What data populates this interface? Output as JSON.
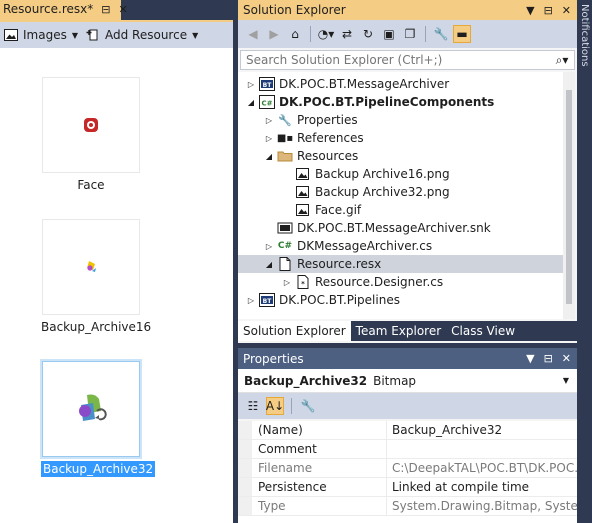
{
  "document_tab": {
    "title": "Resource.resx*",
    "pin_glyph": "⊟",
    "close_glyph": "✕"
  },
  "designer_toolbar": {
    "images_label": "Images",
    "add_resource_label": "Add Resource"
  },
  "resources": [
    {
      "name": "Face",
      "selected": false
    },
    {
      "name": "Backup_Archive16",
      "selected": false
    },
    {
      "name": "Backup_Archive32",
      "selected": true
    }
  ],
  "solution_explorer": {
    "title": "Solution Explorer",
    "search_placeholder": "Search Solution Explorer (Ctrl+;)",
    "tree": [
      {
        "label": "DK.POC.BT.MessageArchiver",
        "indent": 0,
        "expander": "▷",
        "icon": "bt-project-icon",
        "bold": false,
        "selected": false
      },
      {
        "label": "DK.POC.BT.PipelineComponents",
        "indent": 0,
        "expander": "◢",
        "icon": "csharp-project-icon",
        "bold": true,
        "selected": false
      },
      {
        "label": "Properties",
        "indent": 1,
        "expander": "▷",
        "icon": "wrench-icon",
        "bold": false,
        "selected": false
      },
      {
        "label": "References",
        "indent": 1,
        "expander": "▷",
        "icon": "references-icon",
        "bold": false,
        "selected": false
      },
      {
        "label": "Resources",
        "indent": 1,
        "expander": "◢",
        "icon": "folder-icon",
        "bold": false,
        "selected": false
      },
      {
        "label": "Backup Archive16.png",
        "indent": 2,
        "expander": "",
        "icon": "image-file-icon",
        "bold": false,
        "selected": false
      },
      {
        "label": "Backup Archive32.png",
        "indent": 2,
        "expander": "",
        "icon": "image-file-icon",
        "bold": false,
        "selected": false
      },
      {
        "label": "Face.gif",
        "indent": 2,
        "expander": "",
        "icon": "image-file-icon",
        "bold": false,
        "selected": false
      },
      {
        "label": "DK.POC.BT.MessageArchiver.snk",
        "indent": 1,
        "expander": "",
        "icon": "key-file-icon",
        "bold": false,
        "selected": false
      },
      {
        "label": "DKMessageArchiver.cs",
        "indent": 1,
        "expander": "▷",
        "icon": "csharp-file-icon",
        "bold": false,
        "selected": false
      },
      {
        "label": "Resource.resx",
        "indent": 1,
        "expander": "◢",
        "icon": "resx-file-icon",
        "bold": false,
        "selected": true
      },
      {
        "label": "Resource.Designer.cs",
        "indent": 2,
        "expander": "▷",
        "icon": "designer-cs-icon",
        "bold": false,
        "selected": false
      },
      {
        "label": "DK.POC.BT.Pipelines",
        "indent": 0,
        "expander": "▷",
        "icon": "bt-project-icon",
        "bold": false,
        "selected": false
      }
    ],
    "tabs": [
      {
        "label": "Solution Explorer",
        "active": true
      },
      {
        "label": "Team Explorer",
        "active": false
      },
      {
        "label": "Class View",
        "active": false
      }
    ]
  },
  "properties": {
    "title": "Properties",
    "object_name": "Backup_Archive32",
    "object_type": "Bitmap",
    "rows": [
      {
        "name": "(Name)",
        "value": "Backup_Archive32",
        "dim": false
      },
      {
        "name": "Comment",
        "value": "",
        "dim": false
      },
      {
        "name": "Filename",
        "value": "C:\\DeepakTAL\\POC.BT\\DK.POC.BT.",
        "dim": true
      },
      {
        "name": "Persistence",
        "value": "Linked at compile time",
        "dim": false
      },
      {
        "name": "Type",
        "value": "System.Drawing.Bitmap, System.Dra",
        "dim": true
      }
    ]
  },
  "side_panel": {
    "label": "Notifications"
  },
  "colors": {
    "accent_gold": "#f5cc84",
    "frame_navy": "#2f3a52",
    "toolbar_blue": "#cfd6e5",
    "selection_blue": "#3399ff"
  }
}
